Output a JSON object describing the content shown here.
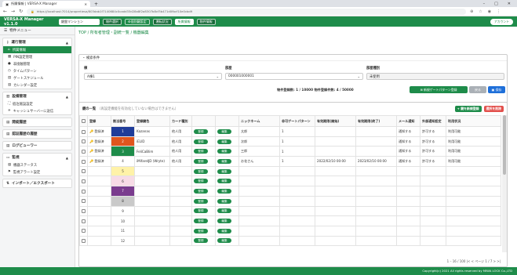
{
  "browser": {
    "tab_title": "所属情報 | VERSA-X Manager",
    "new_tab_symbol": "+",
    "url": "https://localhost:7014/propertiesa/803dab1f7140684c0cadd33d28a8f2a8307b8cf3b471d0fbcf10e0cbd9",
    "window_controls": [
      "–",
      "□",
      "✕"
    ]
  },
  "appbar": {
    "brand": "VERSA-X Manager v1.1.0",
    "mansion_select": "鍵盤マンション",
    "btn_property": "物件選択",
    "btn_keyset": "個別鍵設定",
    "btn_status": "運転状況",
    "btn_management": "所属情報",
    "btn_property_data": "物件情報",
    "account": "アカウント"
  },
  "sidebar": {
    "menu_title": "物件メニュー",
    "groups": [
      {
        "title": "運行管理",
        "items": [
          "所属情報",
          "PIN設定管理",
          "非接触管理",
          "タイムパターン",
          "ゲートスケジュール",
          "カレンダー設定"
        ]
      },
      {
        "title": "設備管理",
        "items": [
          "宿泊施設設定",
          "キャッシュサーバーに送信"
        ]
      },
      {
        "title": "開錠履歴",
        "items": []
      },
      {
        "title": "認証履歴の履歴",
        "items": []
      },
      {
        "title": "ログビューワー",
        "items": []
      },
      {
        "title": "監視",
        "items": [
          "機器ステータス",
          "監視アラート設定"
        ]
      },
      {
        "title": "インポート／エクスポート",
        "items": []
      }
    ]
  },
  "breadcrumb": "TOP / 所有者管理・副統一覧 / 機器編集",
  "search_panel": {
    "title": "検索条件",
    "field1_label": "棟",
    "field1_value": "A棟1",
    "field2_label": "部屋",
    "field2_value": "000001000001",
    "field3_label": "部屋種別",
    "field3_value": "未使用",
    "count_text": "物件登録数: 1 / 10000   物件登録件数: 4 / 50000",
    "btn_add_pattern": "新規ゲートパターン登録",
    "btn_back": "戻る",
    "btn_save": "保存"
  },
  "grid": {
    "title": "鍵の一覧",
    "subtitle": "（再設定機能を有効化していない場合はできません）",
    "btn_new": "+ 鍵を新規登録",
    "btn_delete": "選択を削除",
    "columns": [
      "登録",
      "割当番号",
      "登録鍵色",
      "カード種別",
      "",
      "",
      "ニックネーム",
      "非可ゲートパターン",
      "有効期限(開始)",
      "有効期限(終了)",
      "メール通知",
      "外部通知設定",
      "利用状況"
    ],
    "rows": [
      {
        "reg": "登録済",
        "num": "1",
        "color": "#1f3c99",
        "name": "Kazanas",
        "type": "他人用",
        "nick": "太郎",
        "pattern": "1",
        "start": "",
        "end": "",
        "mail": "通知する",
        "ext": "許可する",
        "status": "利用可能"
      },
      {
        "reg": "登録済",
        "num": "2",
        "color": "#e0561e",
        "name": "iELID",
        "type": "他人用",
        "nick": "次郎",
        "pattern": "1",
        "start": "",
        "end": "",
        "mail": "通知する",
        "ext": "許可する",
        "status": "利用可能"
      },
      {
        "reg": "登録済",
        "num": "3",
        "color": "#1e8c4a",
        "name": "FeliCaBlim",
        "type": "他人用",
        "nick": "三郎",
        "pattern": "1",
        "start": "",
        "end": "",
        "mail": "通知する",
        "ext": "許可する",
        "status": "利用可能"
      },
      {
        "reg": "登録済",
        "num": "4",
        "color": "#ffffff",
        "name": "iMifareIJD (Wryte)",
        "type": "他人用",
        "nick": "お花さん",
        "pattern": "1",
        "start": "2022/02/10 00:00",
        "end": "2023/02/10 00:00",
        "mail": "通知する",
        "ext": "許可する",
        "status": "利用可能"
      },
      {
        "reg": "",
        "num": "5",
        "color": "#fff2a8",
        "name": "",
        "type": "",
        "nick": "",
        "pattern": "",
        "start": "",
        "end": "",
        "mail": "",
        "ext": "",
        "status": ""
      },
      {
        "reg": "",
        "num": "6",
        "color": "#f7dbe6",
        "name": "",
        "type": "",
        "nick": "",
        "pattern": "",
        "start": "",
        "end": "",
        "mail": "",
        "ext": "",
        "status": ""
      },
      {
        "reg": "",
        "num": "7",
        "color": "#7a3c8e",
        "name": "",
        "type": "",
        "nick": "",
        "pattern": "",
        "start": "",
        "end": "",
        "mail": "",
        "ext": "",
        "status": ""
      },
      {
        "reg": "",
        "num": "8",
        "color": "#c9c9c9",
        "name": "",
        "type": "",
        "nick": "",
        "pattern": "",
        "start": "",
        "end": "",
        "mail": "",
        "ext": "",
        "status": ""
      },
      {
        "reg": "",
        "num": "9",
        "color": "#ffffff",
        "name": "",
        "type": "",
        "nick": "",
        "pattern": "",
        "start": "",
        "end": "",
        "mail": "",
        "ext": "",
        "status": ""
      },
      {
        "reg": "",
        "num": "10",
        "color": "#ffffff",
        "name": "",
        "type": "",
        "nick": "",
        "pattern": "",
        "start": "",
        "end": "",
        "mail": "",
        "ext": "",
        "status": ""
      },
      {
        "reg": "",
        "num": "11",
        "color": "#ffffff",
        "name": "",
        "type": "",
        "nick": "",
        "pattern": "",
        "start": "",
        "end": "",
        "mail": "",
        "ext": "",
        "status": ""
      },
      {
        "reg": "",
        "num": "12",
        "color": "#ffffff",
        "name": "",
        "type": "",
        "nick": "",
        "pattern": "",
        "start": "",
        "end": "",
        "mail": "",
        "ext": "",
        "status": ""
      }
    ],
    "pill_edit": "登録",
    "pill_detail": "編集",
    "pager": "1 – 16 / 100     |<  <  ページ 1 / 7  >  >|"
  },
  "footer": "Copyright(c) 2021 All rights reserved by MIWA LOCK Co.,LTD",
  "colors": {
    "accent": "#1e8c4a",
    "blue": "#1e6fd9",
    "red": "#e2504c"
  }
}
